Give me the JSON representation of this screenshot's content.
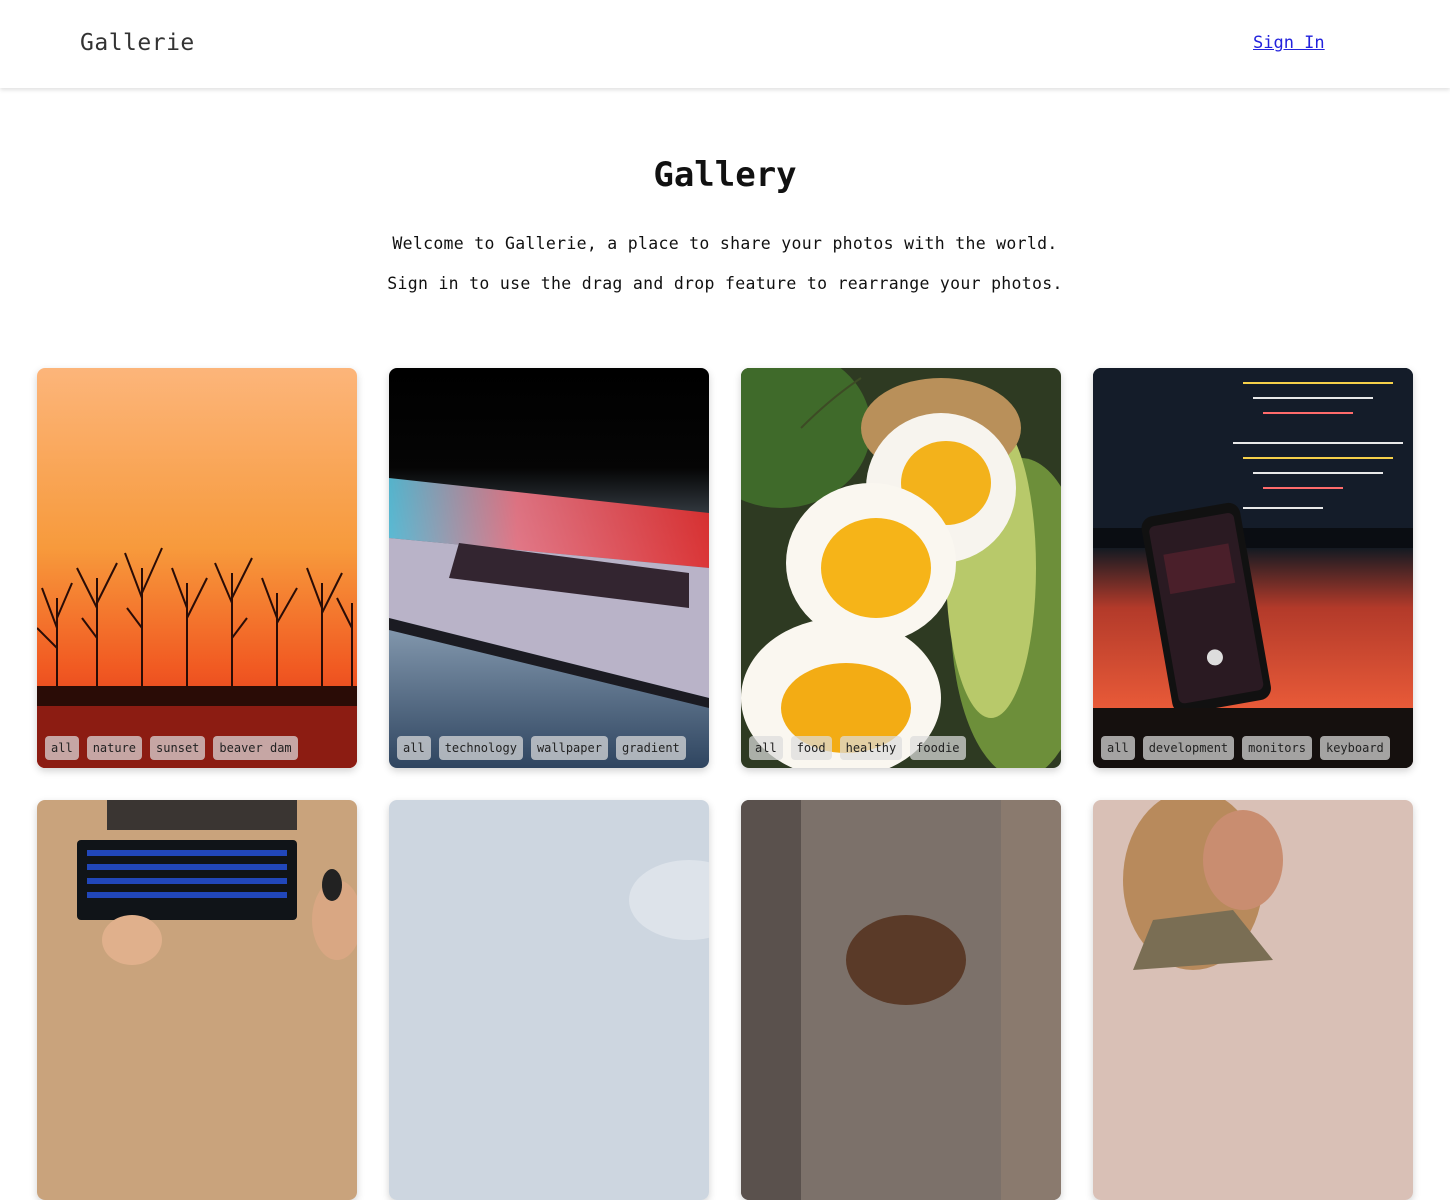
{
  "nav": {
    "brand": "Gallerie",
    "signin_label": "Sign In"
  },
  "hero": {
    "title": "Gallery",
    "line1": "Welcome to Gallerie, a place to share your photos with the world.",
    "line2": "Sign in to use the drag and drop feature to rearrange your photos."
  },
  "cards": [
    {
      "subject": "sunset trees",
      "tags": [
        "all",
        "nature",
        "sunset",
        "beaver dam"
      ]
    },
    {
      "subject": "laptop",
      "tags": [
        "all",
        "technology",
        "wallpaper",
        "gradient"
      ]
    },
    {
      "subject": "boiled eggs",
      "tags": [
        "all",
        "food",
        "healthy",
        "foodie"
      ]
    },
    {
      "subject": "phone and code monitor",
      "tags": [
        "all",
        "development",
        "monitors",
        "keyboard"
      ]
    },
    {
      "subject": "keyboard on desk",
      "tags": []
    },
    {
      "subject": "sky",
      "tags": []
    },
    {
      "subject": "person hair",
      "tags": []
    },
    {
      "subject": "woman portrait",
      "tags": []
    }
  ],
  "colors": {
    "link": "#2222dd",
    "tag_bg": "#dcdcdc"
  }
}
